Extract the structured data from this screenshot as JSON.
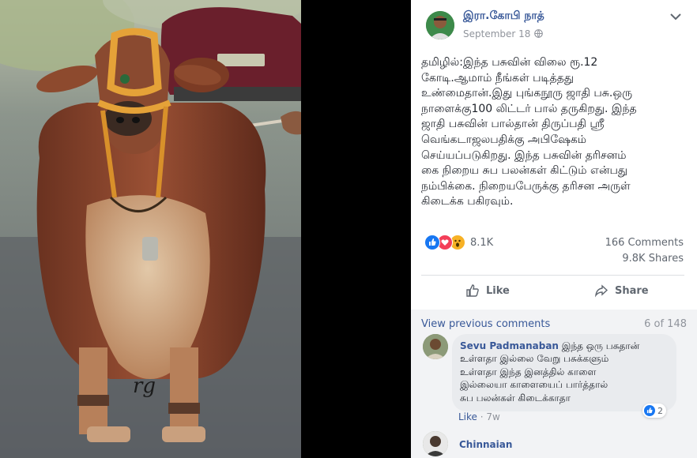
{
  "post": {
    "author": "இரா.கோபி நாத்",
    "date": "September 18",
    "text": "தமிழில்:இந்த பசுவின் விலை ரூ.12\nகோடி.ஆமாம் நீங்கள் படித்தது\nஉண்மைதான்.இது புங்கநூரு ஜாதி பசு.ஒரு\nநாளைக்கு100 லிட்டர் பால் தருகிறது. இந்த\nஜாதி பசுவின் பால்தான் திருப்பதி ஸ்ரீ\nவெங்கடாஜலபதிக்கு அபிஷேகம்\nசெய்யப்படுகிறது. இந்த பசுவின் தரிசனம்\nகை நிறைய சுப பலன்கள் கிட்டும் என்பது\nநம்பிக்கை. நிறையபேருக்கு தரிசன அருள்\nகிடைக்க பகிரவும்.",
    "photo_watermark": "rg"
  },
  "stats": {
    "reaction_icons": [
      "like-icon",
      "love-icon",
      "wow-icon"
    ],
    "reaction_count": "8.1K",
    "comments": "166 Comments",
    "shares": "9.8K Shares"
  },
  "actions": {
    "like": "Like",
    "share": "Share"
  },
  "comments_section": {
    "view_previous": "View previous comments",
    "count": "6 of 148",
    "comments": [
      {
        "name": "Sevu Padmanaban",
        "text": "இந்த ஒரு பசுதான்\nஉள்ளதா இல்லை வேறு பசுக்களும்\nஉள்ளதா இந்த இனத்தில் காளை\nஇல்லையா காளையைப் பார்த்தால்\nசுப பலன்கள் கிடைக்காதா",
        "like_label": "Like",
        "age": "7w",
        "reaction_count": "2"
      },
      {
        "name": "Chinnaian"
      }
    ]
  },
  "colors": {
    "link": "#385898",
    "facebook_blue": "#1877f2",
    "love_red": "#f33e58",
    "wow_yellow": "#f7b125"
  }
}
